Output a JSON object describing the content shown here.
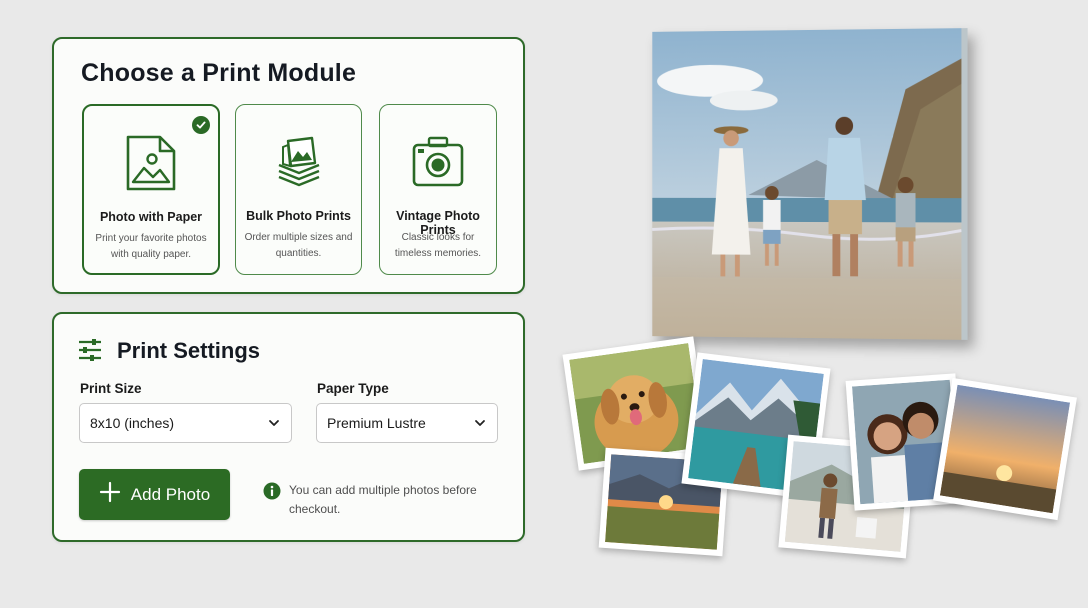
{
  "module_panel": {
    "title": "Choose a Print Module",
    "cards": [
      {
        "title": "Photo with Paper",
        "desc": "Print your favorite photos with quality paper.",
        "icon": "image-file-icon",
        "selected": true
      },
      {
        "title": "Bulk Photo Prints",
        "desc": "Order multiple sizes and quantities.",
        "icon": "photo-stack-icon",
        "selected": false
      },
      {
        "title": "Vintage Photo Prints",
        "desc": "Classic looks for timeless memories.",
        "icon": "camera-icon",
        "selected": false
      }
    ]
  },
  "settings_panel": {
    "title": "Print Settings",
    "icon": "sliders-icon",
    "print_size": {
      "label": "Print Size",
      "value": "8x10 (inches)"
    },
    "paper_type": {
      "label": "Paper Type",
      "value": "Premium Lustre"
    },
    "add_button": {
      "label": "Add Photo",
      "icon": "plus-icon"
    },
    "info": {
      "icon": "info-icon",
      "text": "You can add multiple photos before checkout."
    }
  },
  "colors": {
    "accent": "#2c6b24",
    "border": "#2e6a2a",
    "background": "#e9e9e9"
  },
  "photos": [
    "family-beach-canvas",
    "golden-retriever",
    "mountain-lake-dock",
    "sunset-field",
    "hiker-village",
    "couple-selfie",
    "sunset-sky"
  ]
}
